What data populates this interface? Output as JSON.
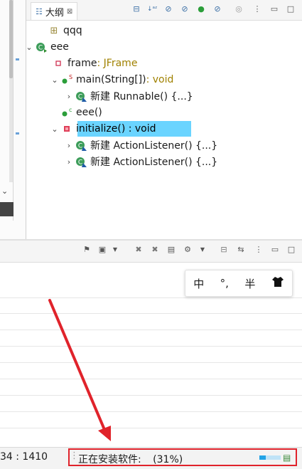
{
  "outline_tab": {
    "title": "大纲",
    "close": "⊠"
  },
  "tree": [
    {
      "label": "qqq",
      "type": ""
    },
    {
      "label": "eee",
      "type": ""
    },
    {
      "label": "frame",
      "type": " : JFrame"
    },
    {
      "label": "main(String[])",
      "type": " : void"
    },
    {
      "label": "新建 Runnable() {...}",
      "type": ""
    },
    {
      "label": "eee()",
      "type": ""
    },
    {
      "label": "initialize() : void",
      "type": ""
    },
    {
      "label": "新建 ActionListener() {...}",
      "type": ""
    },
    {
      "label": "新建 ActionListener() {...}",
      "type": ""
    }
  ],
  "ime": {
    "lang": "中",
    "punct": "°,",
    "width": "半",
    "skin": "skin-icon"
  },
  "status": {
    "position": "34 : 1410",
    "task": "正在安装软件:",
    "percent_text": "(31%)",
    "progress": 0.31
  },
  "colors": {
    "selection": "#6ad4ff",
    "arrow": "#e0232b",
    "progress": "#22a3e6"
  }
}
